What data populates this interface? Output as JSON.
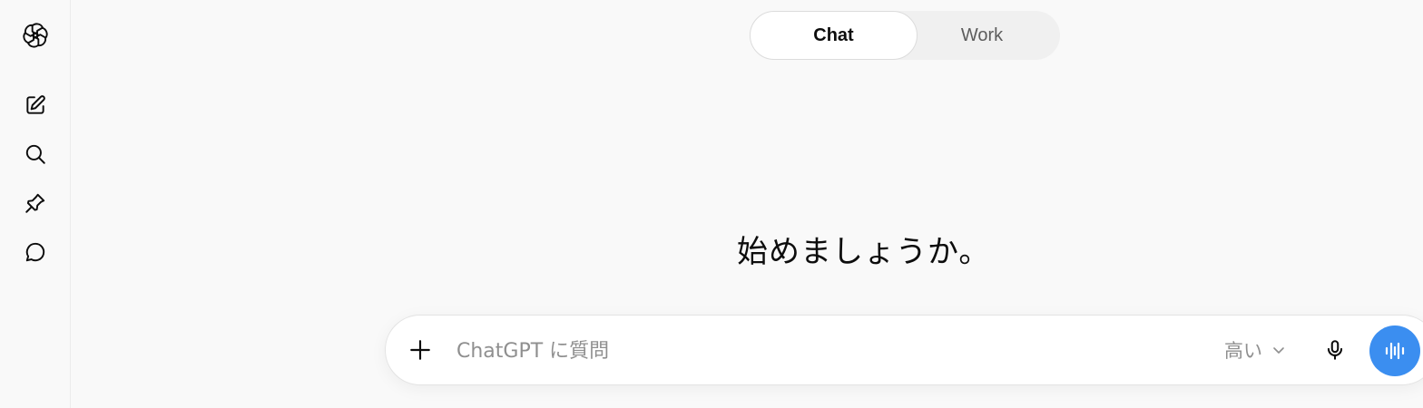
{
  "rail": {
    "items": [
      {
        "icon": "openai-logo-icon"
      },
      {
        "icon": "new-chat-icon"
      },
      {
        "icon": "search-icon"
      },
      {
        "icon": "pin-icon"
      },
      {
        "icon": "chat-bubble-icon"
      }
    ]
  },
  "mode_toggle": {
    "tabs": [
      {
        "label": "Chat",
        "active": true
      },
      {
        "label": "Work",
        "active": false
      }
    ]
  },
  "greeting": "始めましょうか。",
  "composer": {
    "placeholder": "ChatGPT に質問",
    "value": "",
    "model_label": "高い",
    "plus_icon": "plus-icon",
    "mic_icon": "microphone-icon",
    "voice_icon": "voice-waveform-icon"
  },
  "colors": {
    "background": "#f9f9f9",
    "accent": "#3b8ef0",
    "placeholder": "#8f8f8f"
  }
}
